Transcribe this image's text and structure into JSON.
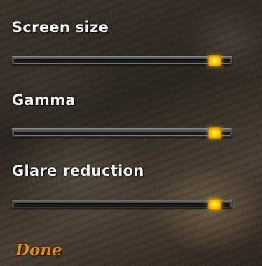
{
  "options": [
    {
      "label": "Screen size",
      "value": 0.94
    },
    {
      "label": "Gamma",
      "value": 0.94
    },
    {
      "label": "Glare reduction",
      "value": 0.94
    }
  ],
  "done_label": "Done",
  "colors": {
    "label_text": "#f2f2f2",
    "thumb": "#ffd400",
    "done_text": "#d98a22"
  }
}
